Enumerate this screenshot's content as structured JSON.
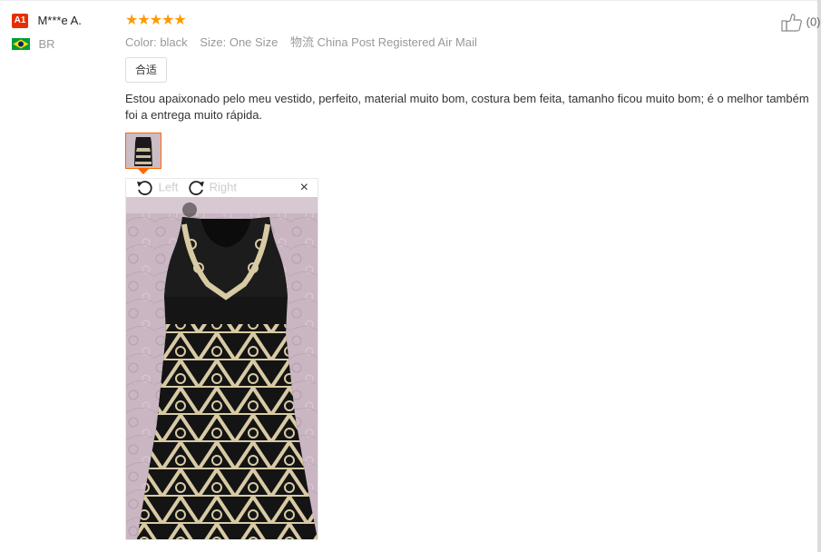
{
  "user": {
    "badge": "A1",
    "name": "M***e A.",
    "country_code": "BR",
    "flag_colors": {
      "green": "#009b3a",
      "yellow": "#fedf00",
      "blue": "#002776"
    },
    "badge_color": "#e62e04"
  },
  "review": {
    "rating": 5,
    "stars": "★★★★★",
    "star_color": "#ff9900",
    "color_label": "Color:",
    "color_value": "black",
    "size_label": "Size:",
    "size_value": "One Size",
    "shipping_label": "物流",
    "shipping_value": "China Post Registered Air Mail",
    "tag": "合适",
    "text": "Estou apaixonado pelo meu vestido, perfeito, material muito bom, costura bem feita, tamanho ficou muito bom; é o melhor também foi a entrega muito rápida.",
    "helpful_count": "(0)"
  },
  "viewer": {
    "rotate_left_label": "Left",
    "rotate_right_label": "Right",
    "close_glyph": "×",
    "accent": "#ff6600"
  }
}
